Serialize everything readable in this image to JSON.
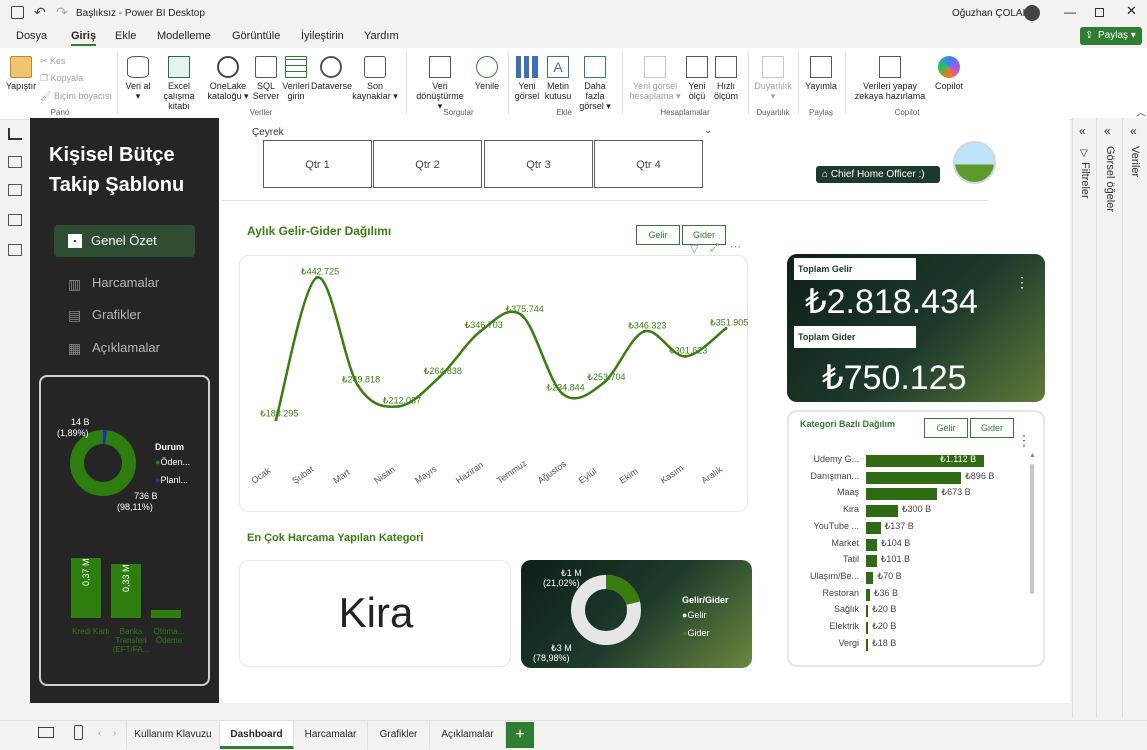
{
  "window": {
    "title": "Başlıksız - Power BI Desktop",
    "user": "Oğuzhan ÇOLAK"
  },
  "menu": {
    "tabs": [
      "Dosya",
      "Giriş",
      "Ekle",
      "Modelleme",
      "Görüntüle",
      "İyileştirin",
      "Yardım"
    ],
    "share": "Paylaş"
  },
  "ribbon": {
    "buttons": {
      "paste": "Yapıştır",
      "cut": "Kes",
      "copy": "Kopyala",
      "format_painter": "Biçim boyacısı",
      "get_data": "Veri al",
      "excel": "Excel çalışma kitabı",
      "onelake": "OneLake kataloğu",
      "sql": "SQL Server",
      "enter_data": "Verileri girin",
      "dataverse": "Dataverse",
      "recent": "Son kaynaklar",
      "transform": "Veri dönüştürme",
      "refresh": "Yenile",
      "new_visual": "Yeni görsel",
      "text_box": "Metin kutusu",
      "more_visuals": "Daha fazla görsel",
      "new_calc": "Yeni görsel hesaplama",
      "new_measure": "Yeni ölçü",
      "quick_measure": "Hızlı ölçüm",
      "sensitivity": "Duyarlılık",
      "publish": "Yayımla",
      "ai_prep": "Verileri yapay zekaya hazırlama",
      "copilot": "Copilot"
    },
    "groups": [
      "Pano",
      "Veriler",
      "Sorgular",
      "Ekle",
      "Hesaplamalar",
      "Duyarlılık",
      "Paylaş",
      "Copilot"
    ]
  },
  "sidebar": {
    "title": "Kişisel Bütçe Takip Şablonu",
    "nav": [
      "Genel Özet",
      "Harcamalar",
      "Grafikler",
      "Açıklamalar"
    ],
    "donut": {
      "label_small": "14 B",
      "label_small_pct": "(1,89%)",
      "label_big": "736 B",
      "label_big_pct": "(98,11%)",
      "legend_title": "Durum",
      "legend": [
        "Öden...",
        "Planl..."
      ]
    },
    "bars": [
      {
        "value_label": "0,37 M",
        "category": "Kredi Kartı",
        "value": 0.37
      },
      {
        "value_label": "0,33 M",
        "category": "Banka Transferi (EFT/FA...",
        "value": 0.33
      },
      {
        "value_label": "",
        "category": "Otoma... Ödeme",
        "value": 0.05
      }
    ]
  },
  "slicer": {
    "title": "Çeyrek",
    "options": [
      "Qtr 1",
      "Qtr 2",
      "Qtr 3",
      "Qtr 4"
    ]
  },
  "badge": "Chief Home Officer :)",
  "line_chart": {
    "title": "Aylık Gelir-Gider Dağılımı",
    "buttons": [
      "Gelir",
      "Gider"
    ]
  },
  "chart_data": {
    "type": "line",
    "title": "Aylık Gelir-Gider Dağılımı",
    "categories": [
      "Ocak",
      "Şubat",
      "Mart",
      "Nisan",
      "Mayıs",
      "Haziran",
      "Temmuz",
      "Ağustos",
      "Eylül",
      "Ekim",
      "Kasım",
      "Aralık"
    ],
    "values": [
      188295,
      442725,
      249818,
      212037,
      264838,
      346703,
      375744,
      234844,
      253704,
      346323,
      301623,
      351905
    ],
    "labels": [
      "₺188.295",
      "₺442.725",
      "₺249.818",
      "₺212.037",
      "₺264.838",
      "₺346.703",
      "₺375.744",
      "₺234.844",
      "₺253.704",
      "₺346.323",
      "₺301.623",
      "₺351.905"
    ],
    "ylim": [
      150000,
      460000
    ],
    "color": "#3a7d0f"
  },
  "kpi": {
    "income_label": "Toplam Gelir",
    "income_value": "₺2.818.434",
    "expense_label": "Toplam Gider",
    "expense_value": "₺750.125"
  },
  "top_category": {
    "title": "En Çok Harcama Yapılan Kategori",
    "value": "Kira"
  },
  "ratio_donut": {
    "small_label": "₺1 M",
    "small_pct": "(21,02%)",
    "big_label": "₺3 M",
    "big_pct": "(78,98%)",
    "legend_title": "Gelir/Gider",
    "legend": [
      "Gelir",
      "Gider"
    ],
    "fractions": [
      0.7898,
      0.2102
    ]
  },
  "category_chart": {
    "title": "Kategori Bazlı Dağılım",
    "buttons": [
      "Gelir",
      "Gider"
    ],
    "items": [
      {
        "name": "Udemy G...",
        "label": "₺1.112 B",
        "value": 1112
      },
      {
        "name": "Danışman...",
        "label": "₺896 B",
        "value": 896
      },
      {
        "name": "Maaş",
        "label": "₺673 B",
        "value": 673
      },
      {
        "name": "Kira",
        "label": "₺300 B",
        "value": 300
      },
      {
        "name": "YouTube ...",
        "label": "₺137 B",
        "value": 137
      },
      {
        "name": "Market",
        "label": "₺104 B",
        "value": 104
      },
      {
        "name": "Tatil",
        "label": "₺101 B",
        "value": 101
      },
      {
        "name": "Ulaşım/Be...",
        "label": "₺70 B",
        "value": 70
      },
      {
        "name": "Restoran",
        "label": "₺36 B",
        "value": 36
      },
      {
        "name": "Sağlık",
        "label": "₺20 B",
        "value": 20
      },
      {
        "name": "Elektrik",
        "label": "₺20 B",
        "value": 20
      },
      {
        "name": "Vergi",
        "label": "₺18 B",
        "value": 18
      }
    ]
  },
  "panes": [
    "Filtreler",
    "Görsel öğeler",
    "Veriler"
  ],
  "pages": [
    "Kullanım Klavuzu",
    "Dashboard",
    "Harcamalar",
    "Grafikler",
    "Açıklamalar"
  ],
  "colors": {
    "accent": "#2e7d32",
    "dark_green": "#1c3a2a",
    "sidebar": "#252525",
    "bar": "#2e6b12"
  }
}
